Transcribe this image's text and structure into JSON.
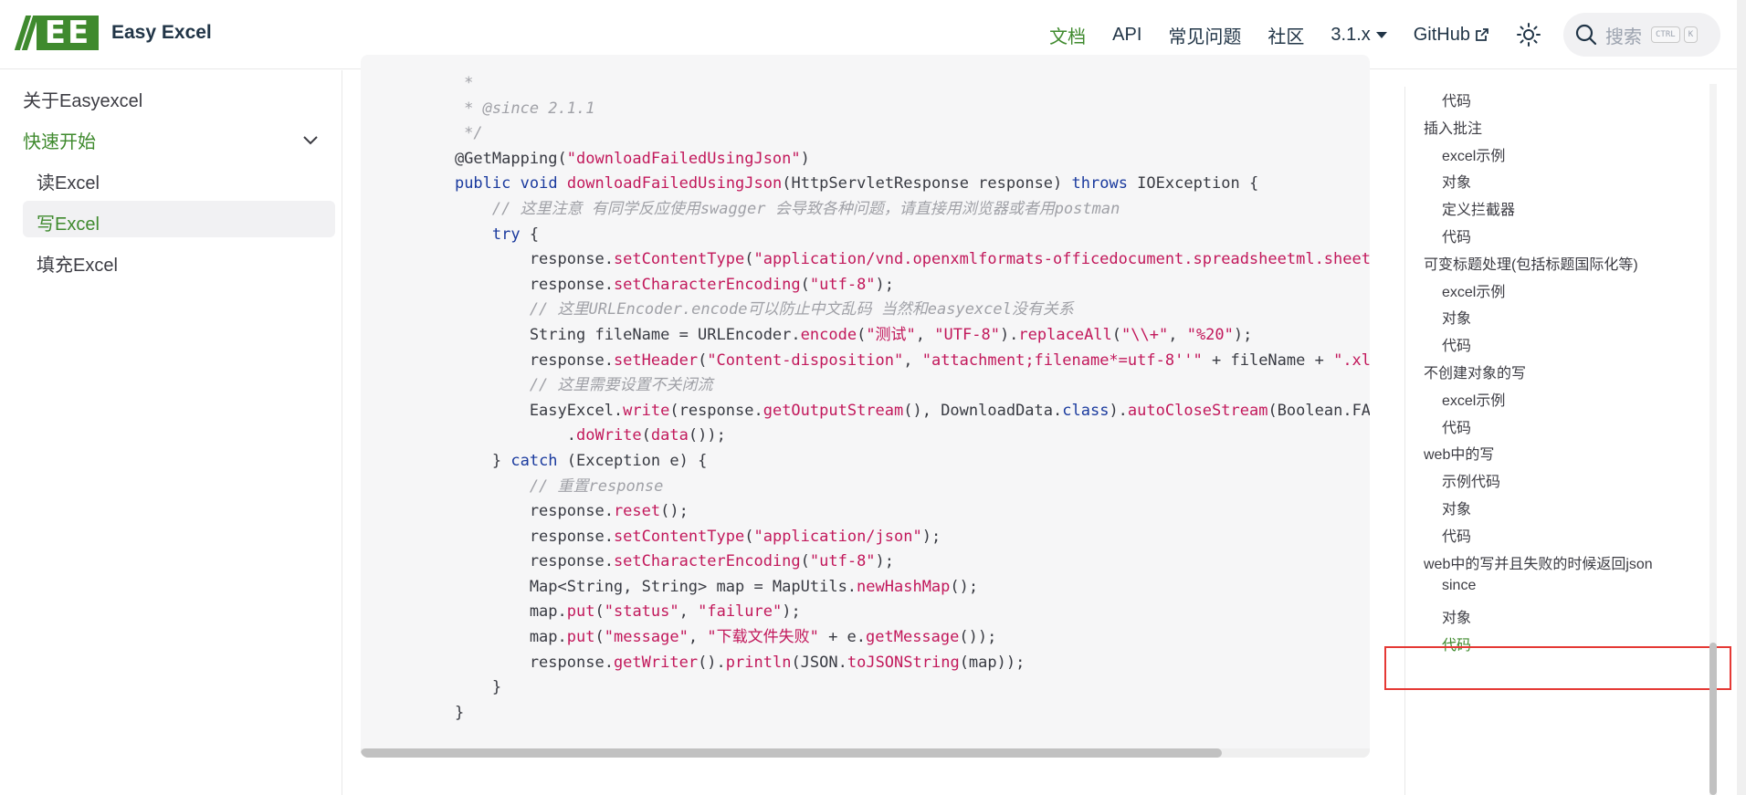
{
  "header": {
    "logo_text": "EE",
    "brand": "Easy Excel",
    "nav": [
      {
        "label": "文档",
        "active": true
      },
      {
        "label": "API"
      },
      {
        "label": "常见问题"
      },
      {
        "label": "社区"
      },
      {
        "label": "3.1.x"
      },
      {
        "label": "GitHub"
      }
    ],
    "search": {
      "placeholder": "搜索",
      "kbd": [
        "CTRL",
        "K"
      ]
    }
  },
  "sidebar": {
    "items": [
      {
        "label": "关于Easyexcel",
        "level": 1
      },
      {
        "label": "快速开始",
        "level": 1,
        "active": true,
        "expanded": true
      },
      {
        "label": "读Excel",
        "level": 2
      },
      {
        "label": "写Excel",
        "level": 2,
        "active": true
      },
      {
        "label": "填充Excel",
        "level": 2
      }
    ]
  },
  "code": {
    "lines": [
      "     * ",
      "     * @since 2.1.1",
      "     */",
      "    @GetMapping(\"downloadFailedUsingJson\")",
      "    public void downloadFailedUsingJson(HttpServletResponse response) throws IOException {",
      "        // 这里注意 有同学反应使用swagger 会导致各种问题，请直接用浏览器或者用postman",
      "        try {",
      "            response.setContentType(\"application/vnd.openxmlformats-officedocument.spreadsheetml.sheet\");",
      "            response.setCharacterEncoding(\"utf-8\");",
      "            // 这里URLEncoder.encode可以防止中文乱码 当然和easyexcel没有关系",
      "            String fileName = URLEncoder.encode(\"测试\", \"UTF-8\").replaceAll(\"\\\\+\", \"%20\");",
      "            response.setHeader(\"Content-disposition\", \"attachment;filename*=utf-8''\" + fileName + \".xlsx\");",
      "            // 这里需要设置不关闭流",
      "            EasyExcel.write(response.getOutputStream(), DownloadData.class).autoCloseStream(Boolean.FALSE)",
      "                .doWrite(data());",
      "        } catch (Exception e) {",
      "            // 重置response",
      "            response.reset();",
      "            response.setContentType(\"application/json\");",
      "            response.setCharacterEncoding(\"utf-8\");",
      "            Map<String, String> map = MapUtils.newHashMap();",
      "            map.put(\"status\", \"failure\");",
      "            map.put(\"message\", \"下载文件失败\" + e.getMessage());",
      "            response.getWriter().println(JSON.toJSONString(map));",
      "        }",
      "    }"
    ]
  },
  "toc": {
    "items": [
      {
        "label": "代码",
        "level": 2
      },
      {
        "label": "插入批注",
        "level": 1
      },
      {
        "label": "excel示例",
        "level": 2
      },
      {
        "label": "对象",
        "level": 2
      },
      {
        "label": "定义拦截器",
        "level": 2
      },
      {
        "label": "代码",
        "level": 2
      },
      {
        "label": "可变标题处理(包括标题国际化等)",
        "level": 1
      },
      {
        "label": "excel示例",
        "level": 2
      },
      {
        "label": "对象",
        "level": 2
      },
      {
        "label": "代码",
        "level": 2
      },
      {
        "label": "不创建对象的写",
        "level": 1
      },
      {
        "label": "excel示例",
        "level": 2
      },
      {
        "label": "代码",
        "level": 2
      },
      {
        "label": "web中的写",
        "level": 1
      },
      {
        "label": "示例代码",
        "level": 2
      },
      {
        "label": "对象",
        "level": 2
      },
      {
        "label": "代码",
        "level": 2
      },
      {
        "label": "web中的写并且失败的时候返回json",
        "level": 1,
        "highlighted": true
      },
      {
        "label": "since",
        "level": 2
      },
      {
        "label": "对象",
        "level": 2
      },
      {
        "label": "代码",
        "level": 2,
        "active": true
      }
    ]
  },
  "colors": {
    "accent": "#3f8a2e",
    "highlight_box": "#e53935"
  }
}
